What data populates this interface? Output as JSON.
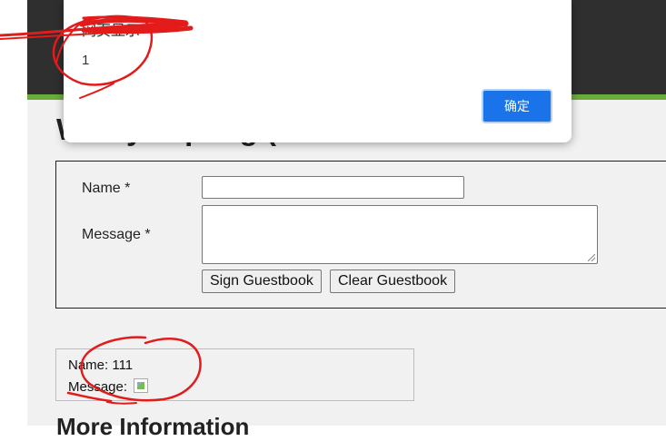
{
  "page": {
    "heading": "W   ...   y   ...   pting (X",
    "more_heading": "More Information"
  },
  "form": {
    "name_label": "Name *",
    "name_value": "",
    "message_label": "Message *",
    "message_value": "",
    "sign_button": "Sign Guestbook",
    "clear_button": "Clear Guestbook"
  },
  "entry": {
    "name_line": "Name: 111",
    "message_label": "Message:"
  },
  "dialog": {
    "title": "网页显示",
    "message": "1",
    "ok_button": "确定",
    "ok_color": "#1a73e8"
  },
  "colors": {
    "header_bg": "#2f2f2f",
    "accent": "#6aac3b",
    "content_bg": "#f1f1f1",
    "annotation": "#e21b1b"
  }
}
